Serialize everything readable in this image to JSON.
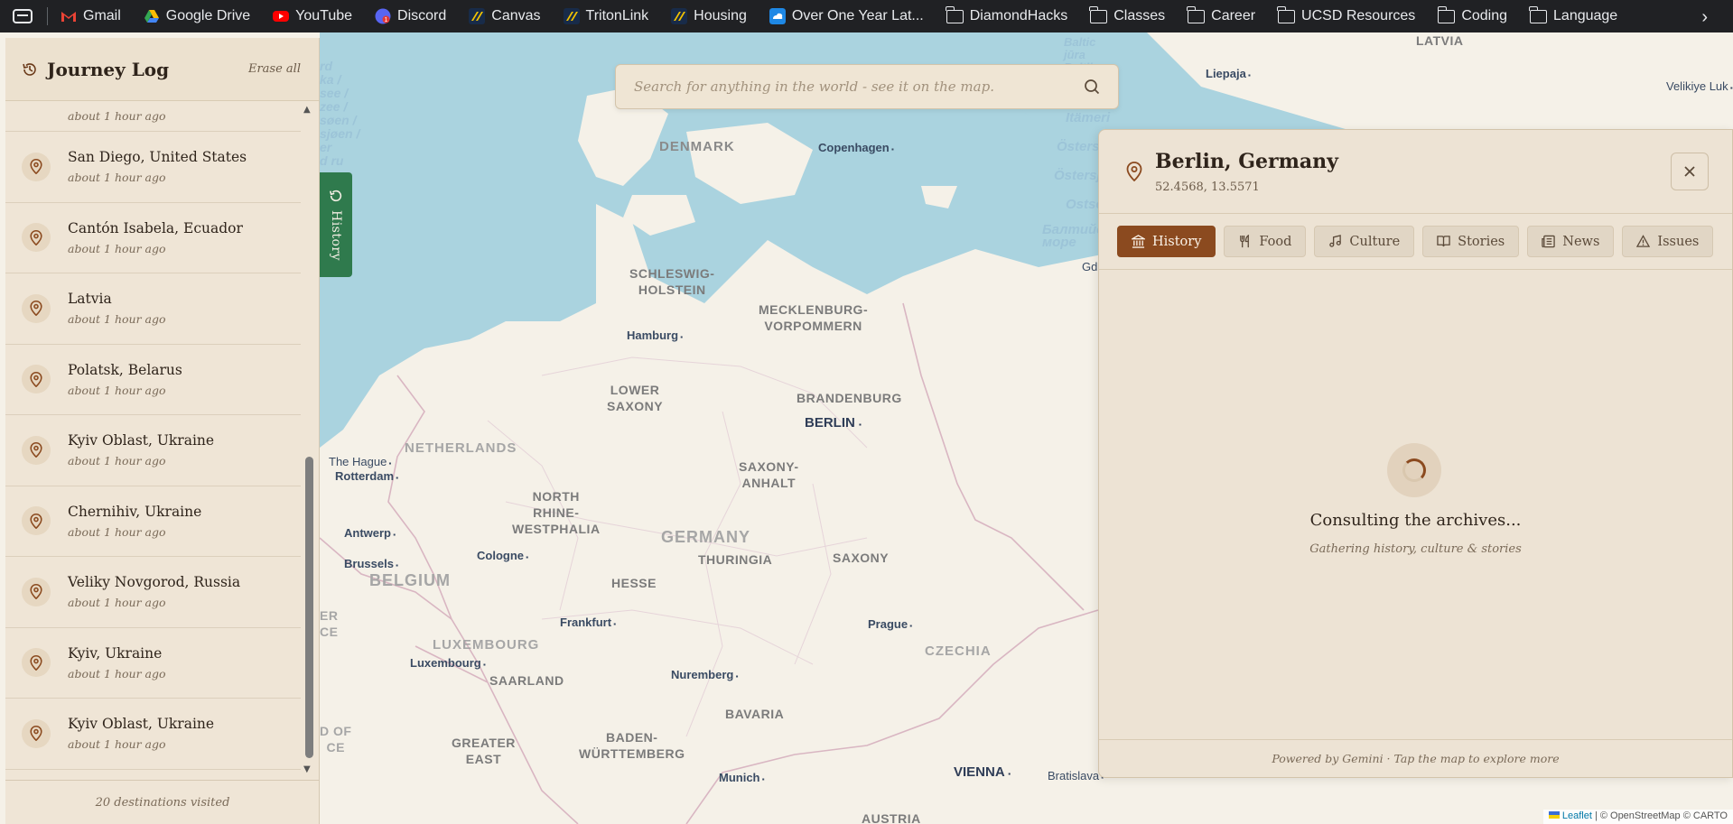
{
  "bookmarks": {
    "items": [
      {
        "label": "Gmail",
        "icon": "gmail-icon",
        "color": "#ea4335"
      },
      {
        "label": "Google Drive",
        "icon": "google-drive-icon",
        "color": "#fbbc04"
      },
      {
        "label": "YouTube",
        "icon": "youtube-icon",
        "color": "#ff0000"
      },
      {
        "label": "Discord",
        "icon": "discord-icon",
        "color": "#5865f2"
      },
      {
        "label": "Canvas",
        "icon": "canvas-icon",
        "color": "#f2c200"
      },
      {
        "label": "TritonLink",
        "icon": "tritonlink-icon",
        "color": "#f2c200"
      },
      {
        "label": "Housing",
        "icon": "housing-icon",
        "color": "#f2c200"
      },
      {
        "label": "Over One Year Lat...",
        "icon": "cloud-icon",
        "color": "#1e88e5"
      },
      {
        "label": "DiamondHacks",
        "icon": "folder-icon"
      },
      {
        "label": "Classes",
        "icon": "folder-icon"
      },
      {
        "label": "Career",
        "icon": "folder-icon"
      },
      {
        "label": "UCSD Resources",
        "icon": "folder-icon"
      },
      {
        "label": "Coding",
        "icon": "folder-icon"
      },
      {
        "label": "Language",
        "icon": "folder-icon"
      }
    ]
  },
  "sidebar": {
    "title": "Journey Log",
    "erase_label": "Erase all",
    "partial_item_time": "about 1 hour ago",
    "items": [
      {
        "name": "San Diego, United States",
        "time": "about 1 hour ago"
      },
      {
        "name": "Cantón Isabela, Ecuador",
        "time": "about 1 hour ago"
      },
      {
        "name": "Latvia",
        "time": "about 1 hour ago"
      },
      {
        "name": "Polatsk, Belarus",
        "time": "about 1 hour ago"
      },
      {
        "name": "Kyiv Oblast, Ukraine",
        "time": "about 1 hour ago"
      },
      {
        "name": "Chernihiv, Ukraine",
        "time": "about 1 hour ago"
      },
      {
        "name": "Veliky Novgorod, Russia",
        "time": "about 1 hour ago"
      },
      {
        "name": "Kyiv, Ukraine",
        "time": "about 1 hour ago"
      },
      {
        "name": "Kyiv Oblast, Ukraine",
        "time": "about 1 hour ago"
      }
    ],
    "footer": "20 destinations visited"
  },
  "history_tab": {
    "label": "History"
  },
  "search": {
    "placeholder": "Search for anything in the world - see it on the map."
  },
  "panel": {
    "title": "Berlin, Germany",
    "coords": "52.4568, 13.5571",
    "tabs": [
      {
        "label": "History",
        "icon": "landmark-icon",
        "active": true
      },
      {
        "label": "Food",
        "icon": "utensils-icon",
        "active": false
      },
      {
        "label": "Culture",
        "icon": "music-icon",
        "active": false
      },
      {
        "label": "Stories",
        "icon": "book-icon",
        "active": false
      },
      {
        "label": "News",
        "icon": "newspaper-icon",
        "active": false
      },
      {
        "label": "Issues",
        "icon": "warning-icon",
        "active": false
      }
    ],
    "loading_title": "Consulting the archives...",
    "loading_sub": "Gathering history, culture & stories",
    "footer": "Powered by Gemini · Tap the map to explore more"
  },
  "map": {
    "labels": {
      "denmark": "DENMARK",
      "copenhagen": "Copenhagen",
      "schleswig_holstein": "SCHLESWIG-\nHOLSTEIN",
      "mecklenburg": "MECKLENBURG-\nVORPOMMERN",
      "hamburg": "Hamburg",
      "lower_saxony": "LOWER\nSAXONY",
      "brandenburg": "BRANDENBURG",
      "berlin": "BERLIN",
      "netherlands": "NETHERLANDS",
      "the_hague": "The Hague",
      "rotterdam": "Rotterdam",
      "saxony_anhalt": "SAXONY-\nANHALT",
      "north_rhine": "NORTH\nRHINE-\nWESTPHALIA",
      "germany": "GERMANY",
      "thuringia": "THURINGIA",
      "saxony": "SAXONY",
      "antwerp": "Antwerp",
      "brussels": "Brussels",
      "cologne": "Cologne",
      "belgium": "BELGIUM",
      "hesse": "HESSE",
      "frankfurt": "Frankfurt",
      "prague": "Prague",
      "czechia": "CZECHIA",
      "luxembourg_country": "LUXEMBOURG",
      "luxembourg_city": "Luxembourg",
      "saarland": "SAARLAND",
      "nuremberg": "Nuremberg",
      "bavaria": "BAVARIA",
      "baden": "BADEN-\nWÜRTTEMBERG",
      "greater_east": "GREATER\nEAST",
      "munich": "Munich",
      "vienna": "VIENNA",
      "bratislava": "Bratislava",
      "austria": "AUSTRIA",
      "liepaja": "Liepaja",
      "latvia": "LATVIA",
      "velikiye": "Velikiye Luk",
      "itameri": "Itämeri",
      "ostersjon": "Östersjön",
      "ostsee": "Ostsee",
      "baltic_ru": "Балтийское\nморе",
      "left_sea": "rd\nka /\nsee /\nzee /\nsøen /\nsjøen /\ner\nd ru",
      "left_france": "ER\nCE",
      "left_of": "D OF\nCE",
      "gd": "Gd",
      "baltic_top": "Baltic\njūra\nBaltijas\njūra"
    }
  },
  "attribution": {
    "leaflet": "Leaflet",
    "rest": "| © OpenStreetMap © CARTO"
  },
  "colors": {
    "accent": "#8b4a1f",
    "history_tab": "#2f7a4d",
    "water": "#aad3df"
  }
}
